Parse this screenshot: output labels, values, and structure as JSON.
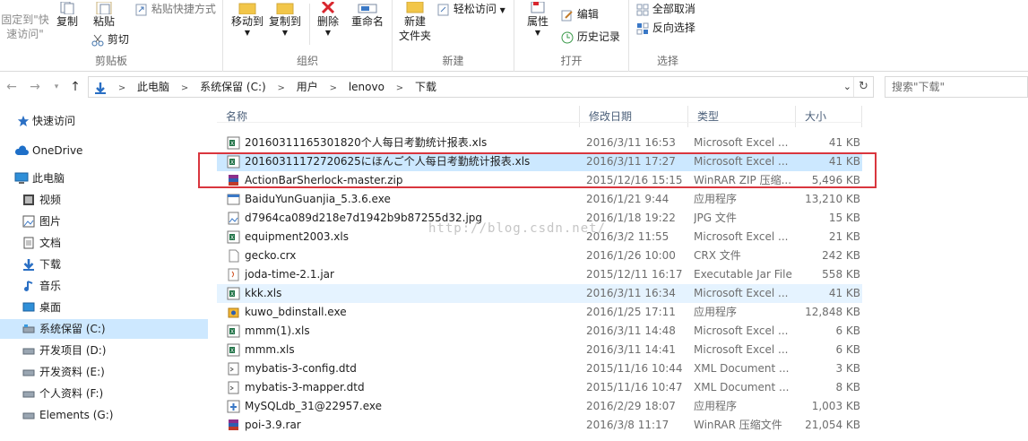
{
  "ribbon": {
    "clipboard": {
      "pin_label_line1": "固定到\"快",
      "pin_label_line2": "速访问\"",
      "copy": "复制",
      "paste": "粘贴",
      "paste_shortcut": "粘贴快捷方式",
      "cut": "剪切",
      "group": "剪贴板"
    },
    "organize": {
      "move_to": "移动到",
      "copy_to": "复制到",
      "delete": "删除",
      "rename": "重命名",
      "group": "组织"
    },
    "new": {
      "new_folder_line1": "新建",
      "new_folder_line2": "文件夹",
      "easy_access": "轻松访问",
      "group": "新建"
    },
    "open": {
      "properties": "属性",
      "edit": "编辑",
      "history": "历史记录",
      "group": "打开"
    },
    "select": {
      "select_none": "全部取消",
      "invert": "反向选择",
      "group": "选择"
    }
  },
  "address": {
    "crumbs": [
      "此电脑",
      "系统保留 (C:)",
      "用户",
      "lenovo",
      "下载"
    ],
    "search_placeholder": "搜索\"下载\""
  },
  "nav": {
    "items": [
      {
        "label": "快速访问",
        "icon": "star-icon"
      },
      {
        "label": "OneDrive",
        "icon": "cloud-icon"
      },
      {
        "label": "此电脑",
        "icon": "computer-icon"
      },
      {
        "label": "视频",
        "icon": "video-icon"
      },
      {
        "label": "图片",
        "icon": "picture-icon"
      },
      {
        "label": "文档",
        "icon": "document-icon"
      },
      {
        "label": "下载",
        "icon": "download-icon"
      },
      {
        "label": "音乐",
        "icon": "music-icon"
      },
      {
        "label": "桌面",
        "icon": "desktop-icon"
      },
      {
        "label": "系统保留 (C:)",
        "icon": "drive-icon"
      },
      {
        "label": "开发项目 (D:)",
        "icon": "drive-icon"
      },
      {
        "label": "开发资料 (E:)",
        "icon": "drive-icon"
      },
      {
        "label": "个人资料 (F:)",
        "icon": "drive-icon"
      },
      {
        "label": "Elements (G:)",
        "icon": "drive-icon"
      }
    ]
  },
  "list": {
    "columns": {
      "name": "名称",
      "date": "修改日期",
      "type": "类型",
      "size": "大小"
    },
    "files": [
      {
        "name": "20160311165301820个人每日考勤统计报表.xls",
        "date": "2016/3/11 16:53",
        "type": "Microsoft Excel ...",
        "size": "41 KB",
        "icon": "excel-icon"
      },
      {
        "name": "20160311172720625にほんご个人每日考勤統计报表.xls",
        "date": "2016/3/11 17:27",
        "type": "Microsoft Excel ...",
        "size": "41 KB",
        "icon": "excel-icon"
      },
      {
        "name": "ActionBarSherlock-master.zip",
        "date": "2015/12/16 15:15",
        "type": "WinRAR ZIP 压缩...",
        "size": "5,496 KB",
        "icon": "winrar-icon"
      },
      {
        "name": "BaiduYunGuanjia_5.3.6.exe",
        "date": "2016/1/21 9:44",
        "type": "应用程序",
        "size": "13,210 KB",
        "icon": "exe-icon"
      },
      {
        "name": "d7964ca089d218e7d1942b9b87255d32.jpg",
        "date": "2016/1/18 19:22",
        "type": "JPG 文件",
        "size": "15 KB",
        "icon": "image-icon"
      },
      {
        "name": "equipment2003.xls",
        "date": "2016/3/2 11:55",
        "type": "Microsoft Excel ...",
        "size": "21 KB",
        "icon": "excel-icon"
      },
      {
        "name": "gecko.crx",
        "date": "2016/1/26 10:00",
        "type": "CRX 文件",
        "size": "242 KB",
        "icon": "blank-file-icon"
      },
      {
        "name": "joda-time-2.1.jar",
        "date": "2015/12/11 16:17",
        "type": "Executable Jar File",
        "size": "558 KB",
        "icon": "jar-icon"
      },
      {
        "name": "kkk.xls",
        "date": "2016/3/11 16:34",
        "type": "Microsoft Excel ...",
        "size": "41 KB",
        "icon": "excel-icon"
      },
      {
        "name": "kuwo_bdinstall.exe",
        "date": "2016/1/25 17:11",
        "type": "应用程序",
        "size": "12,848 KB",
        "icon": "installer-icon"
      },
      {
        "name": "mmm(1).xls",
        "date": "2016/3/11 14:48",
        "type": "Microsoft Excel ...",
        "size": "6 KB",
        "icon": "excel-icon"
      },
      {
        "name": "mmm.xls",
        "date": "2016/3/11 14:41",
        "type": "Microsoft Excel ...",
        "size": "6 KB",
        "icon": "excel-icon"
      },
      {
        "name": "mybatis-3-config.dtd",
        "date": "2015/11/16 10:44",
        "type": "XML Document ...",
        "size": "3 KB",
        "icon": "xml-icon"
      },
      {
        "name": "mybatis-3-mapper.dtd",
        "date": "2015/11/16 10:47",
        "type": "XML Document ...",
        "size": "8 KB",
        "icon": "xml-icon"
      },
      {
        "name": "MySQLdb_31@22957.exe",
        "date": "2016/2/29 18:07",
        "type": "应用程序",
        "size": "1,003 KB",
        "icon": "python-exe-icon"
      },
      {
        "name": "poi-3.9.rar",
        "date": "2016/3/8 11:17",
        "type": "WinRAR 压缩文件",
        "size": "21,054 KB",
        "icon": "winrar-icon"
      }
    ]
  },
  "watermark": "http://blog.csdn.net/"
}
